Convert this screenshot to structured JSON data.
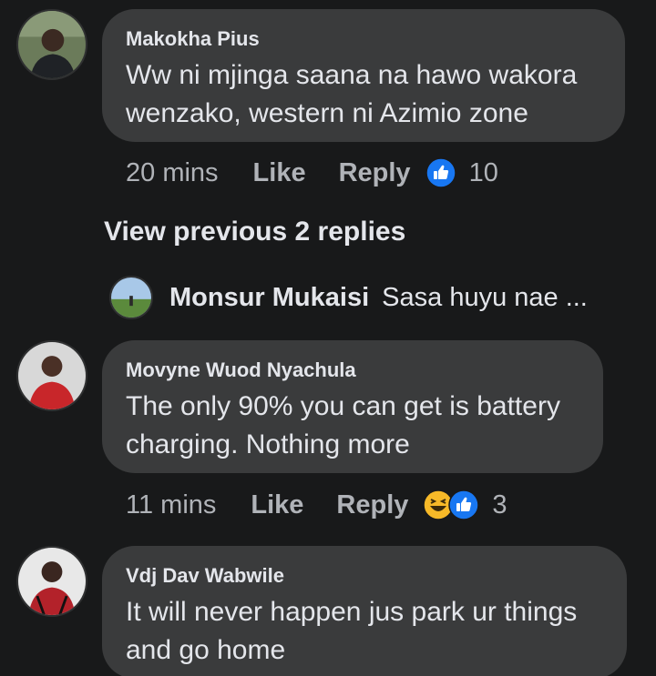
{
  "comments": [
    {
      "author": "Makokha Pius",
      "text_line1": "Ww ni mjinga saana na hawo wakora",
      "text_line2": "wenzako, western ni Azimio zone",
      "time": "20 mins",
      "like_label": "Like",
      "reply_label": "Reply",
      "reaction_count": "10",
      "reactions": [
        "like-reaction-icon"
      ]
    },
    {
      "author": "Movyne Wuod Nyachula",
      "text_line1": "The only 90% you can get is battery",
      "text_line2": "charging. Nothing more",
      "time": "11 mins",
      "like_label": "Like",
      "reply_label": "Reply",
      "reaction_count": "3",
      "reactions": [
        "haha-reaction-icon",
        "like-reaction-icon"
      ]
    },
    {
      "author": "Vdj Dav Wabwile",
      "text_line1": "It will never happen jus park ur things",
      "text_line2": "and go home"
    }
  ],
  "view_previous": "View previous 2 replies",
  "reply_preview": {
    "name": "Monsur Mukaisi",
    "text": "Sasa huyu nae ..."
  },
  "colors": {
    "background": "#18191a",
    "bubble": "#3a3b3c",
    "primary_text": "#e4e6eb",
    "secondary_text": "#b0b3b8",
    "like_blue": "#1877f2",
    "haha_yellow": "#f7b928"
  }
}
